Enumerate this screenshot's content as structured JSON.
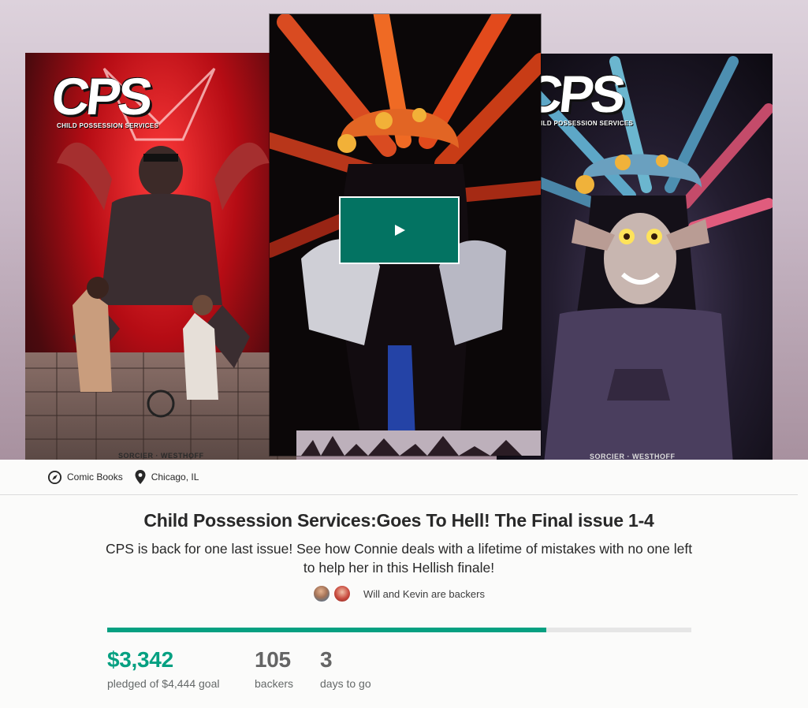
{
  "hero": {
    "left_cover": {
      "logo": "CPS",
      "subtitle": "CHILD POSSESSION SERVICES",
      "credit": "SORCIER · WESTHOFF"
    },
    "right_cover": {
      "logo": "CPS",
      "subtitle": "CHILD POSSESSION SERVICES",
      "credit": "SORCIER · WESTHOFF"
    },
    "play_icon": "play-icon"
  },
  "meta": {
    "category": {
      "icon": "compass-icon",
      "label": "Comic Books"
    },
    "location": {
      "icon": "location-pin-icon",
      "label": "Chicago, IL"
    }
  },
  "project": {
    "title": "Child Possession Services:Goes To Hell! The Final issue 1-4",
    "blurb": "CPS is back for one last issue! See how Connie deals with a lifetime of mistakes with no one left to help her in this Hellish finale!",
    "backers_note": "Will and Kevin are backers"
  },
  "funding": {
    "pledged": "$3,342",
    "pledged_label": "pledged of $4,444 goal",
    "backers": "105",
    "backers_label": "backers",
    "days": "3",
    "days_label": "days to go",
    "progress_fraction": 0.752
  },
  "colors": {
    "accent": "#05a081",
    "play_button": "#037362",
    "text": "#282828"
  }
}
